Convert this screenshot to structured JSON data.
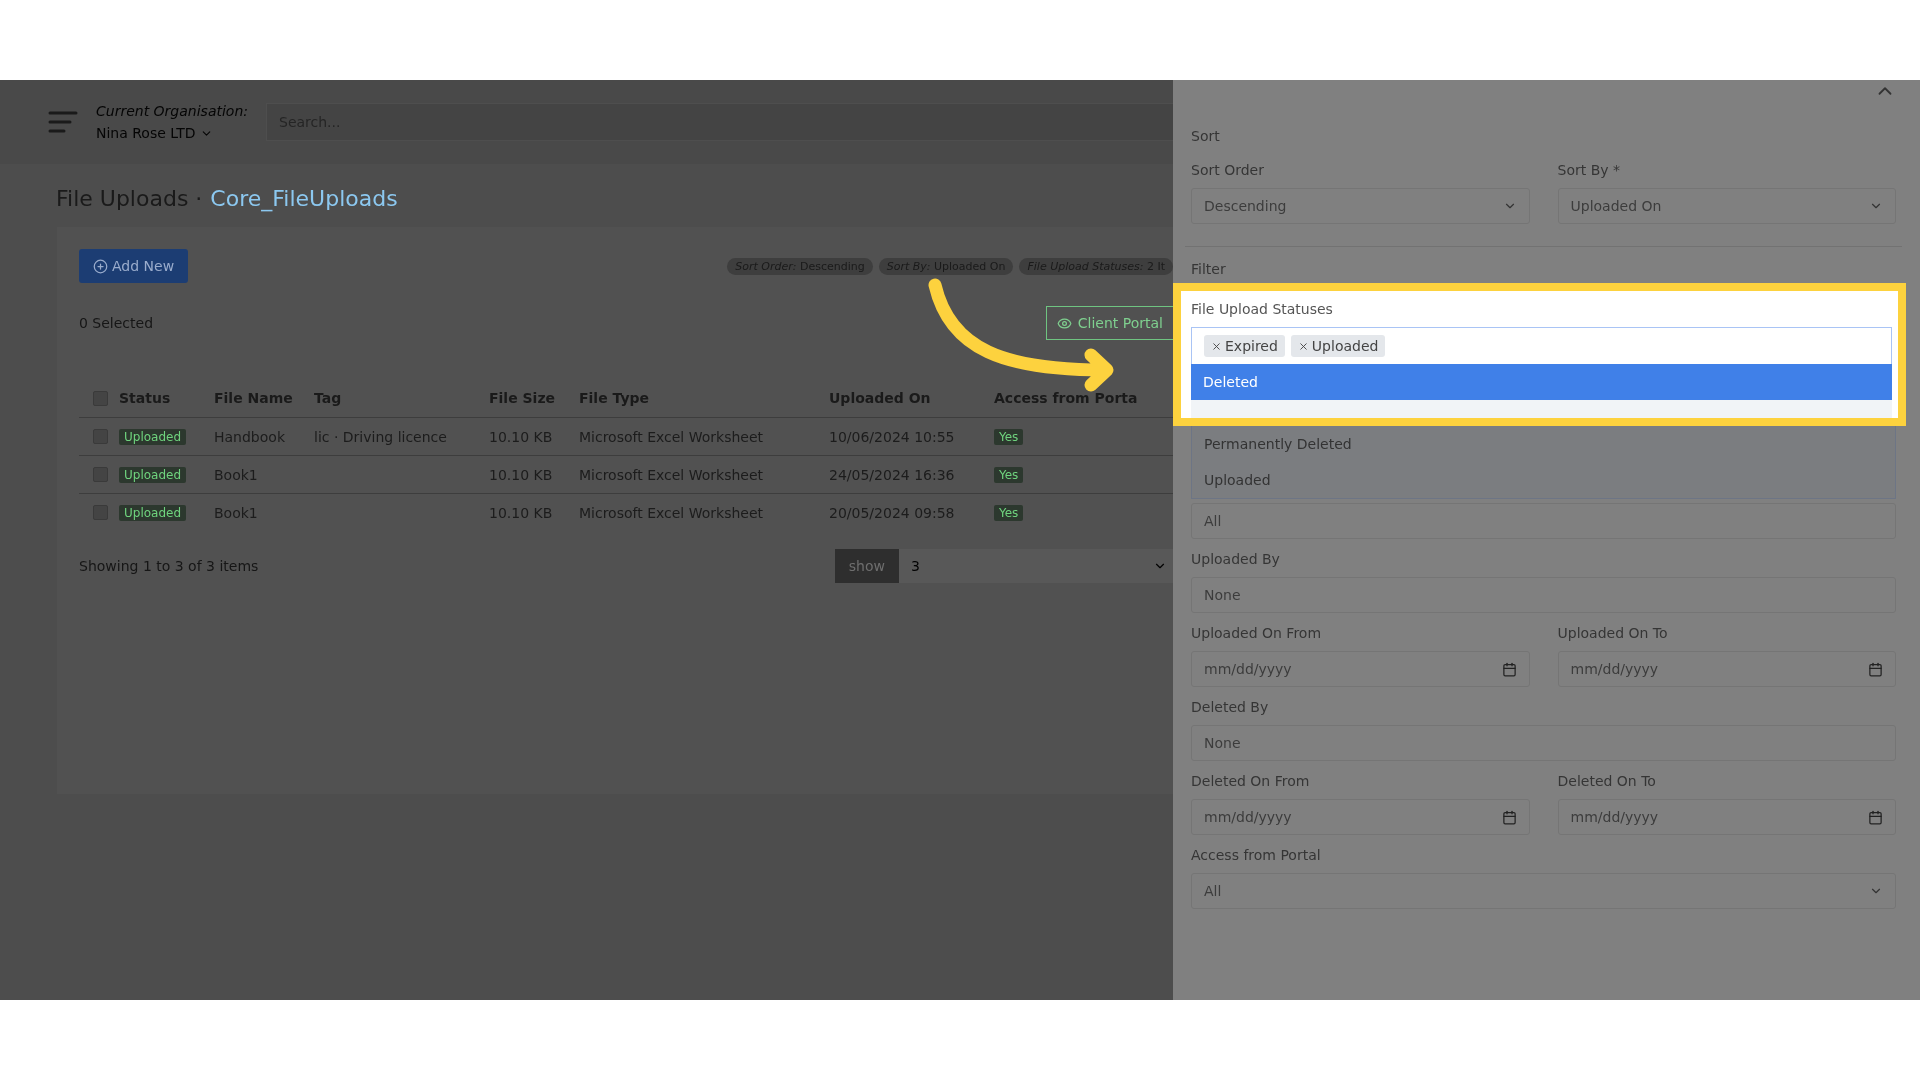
{
  "top_bar": {
    "org_label": "Current Organisation:",
    "org_name": "Nina Rose LTD",
    "search": {
      "placeholder": "Search..."
    }
  },
  "page": {
    "title": "File Uploads",
    "separator": "·",
    "subtitle": "Core_FileUploads"
  },
  "toolbar": {
    "add_button": "Add New",
    "chips": [
      {
        "label": "Sort Order:",
        "value": "Descending"
      },
      {
        "label": "Sort By:",
        "value": "Uploaded On"
      },
      {
        "label": "File Upload Statuses:",
        "value": "2 It"
      }
    ]
  },
  "selection": {
    "count_text": "0 Selected",
    "client_portal_button": "Client Portal"
  },
  "table": {
    "select_all_checked": false,
    "columns": [
      "Status",
      "File Name",
      "Tag",
      "File Size",
      "File Type",
      "Uploaded On",
      "Access from Porta"
    ],
    "rows": [
      {
        "checked": false,
        "status": "Uploaded",
        "file_name": "Handbook",
        "tag": "lic · Driving licence",
        "file_size": "10.10 KB",
        "file_type": "Microsoft Excel Worksheet",
        "uploaded_on": "10/06/2024 10:55",
        "access": "Yes"
      },
      {
        "checked": false,
        "status": "Uploaded",
        "file_name": "Book1",
        "file_size": "10.10 KB",
        "file_type": "Microsoft Excel Worksheet",
        "uploaded_on": "24/05/2024 16:36",
        "access": "Yes"
      },
      {
        "checked": false,
        "status": "Uploaded",
        "file_name": "Book1",
        "file_size": "10.10 KB",
        "file_type": "Microsoft Excel Worksheet",
        "uploaded_on": "20/05/2024 09:58",
        "access": "Yes"
      }
    ]
  },
  "footer": {
    "summary": "Showing 1 to 3 of 3 items",
    "show_button": "show",
    "page_size": "3"
  },
  "filter_panel": {
    "sort_heading": "Sort",
    "sort_fields": [
      {
        "kind": "select",
        "label": "Sort Order",
        "value": "Descending"
      },
      {
        "kind": "select",
        "label": "Sort By *",
        "value": "Uploaded On"
      }
    ],
    "filter_heading": "Filter",
    "statuses": {
      "label": "File Upload Statuses",
      "tags": [
        "Expired",
        "Uploaded"
      ],
      "options": [
        {
          "label": "Deleted",
          "selected": true
        },
        {
          "label": "Permanently Deleted",
          "selected": false
        },
        {
          "label": "Uploaded",
          "selected": false
        }
      ]
    },
    "filter_rows": [
      [
        {
          "kind": "text",
          "value": "All"
        }
      ],
      [
        {
          "kind": "text",
          "label": "Uploaded By",
          "placeholder": "None"
        }
      ],
      [
        {
          "kind": "date",
          "label": "Uploaded On From",
          "placeholder": "mm/dd/yyyy"
        },
        {
          "kind": "date",
          "label": "Uploaded On To",
          "placeholder": "mm/dd/yyyy"
        }
      ],
      [
        {
          "kind": "text",
          "label": "Deleted By",
          "placeholder": "None"
        }
      ],
      [
        {
          "kind": "date",
          "label": "Deleted On From",
          "placeholder": "mm/dd/yyyy"
        },
        {
          "kind": "date",
          "label": "Deleted On To",
          "placeholder": "mm/dd/yyyy"
        }
      ],
      [
        {
          "kind": "select",
          "label": "Access from Portal",
          "value": "All"
        }
      ]
    ]
  }
}
